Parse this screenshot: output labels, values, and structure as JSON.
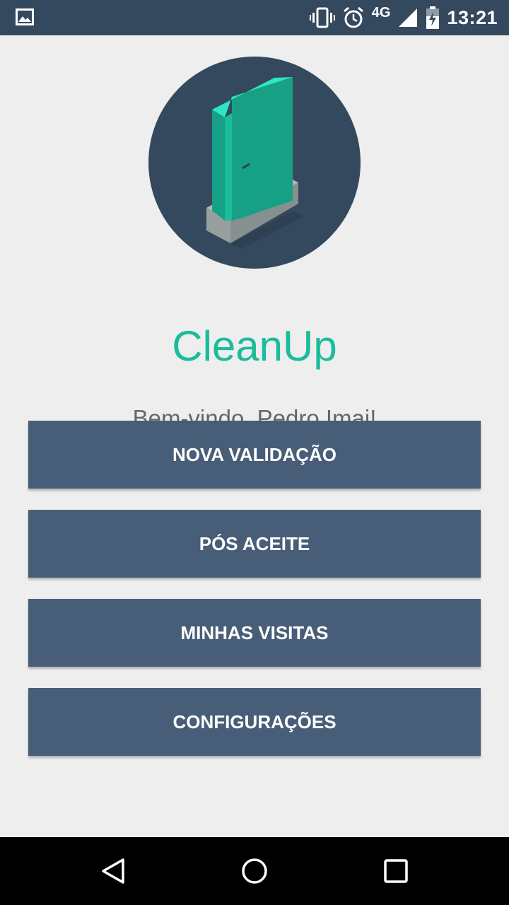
{
  "status_bar": {
    "network": "4G",
    "time": "13:21",
    "icons": [
      "image-icon",
      "vibrate-icon",
      "alarm-icon",
      "signal-icon",
      "battery-charging-icon"
    ]
  },
  "app": {
    "title": "CleanUp",
    "welcome": "Bem-vindo, Pedro Imai!",
    "logo_icon": "door-icon"
  },
  "menu": {
    "buttons": [
      {
        "label": "NOVA VALIDAÇÃO"
      },
      {
        "label": "PÓS ACEITE"
      },
      {
        "label": "MINHAS VISITAS"
      },
      {
        "label": "CONFIGURAÇÕES"
      }
    ]
  },
  "nav_bar": {
    "icons": [
      "back-icon",
      "home-icon",
      "recents-icon"
    ]
  },
  "colors": {
    "status_bar": "#34495e",
    "accent": "#1abc9c",
    "button": "#485d77",
    "background": "#eeeeee",
    "logo_circle": "#34495e"
  }
}
